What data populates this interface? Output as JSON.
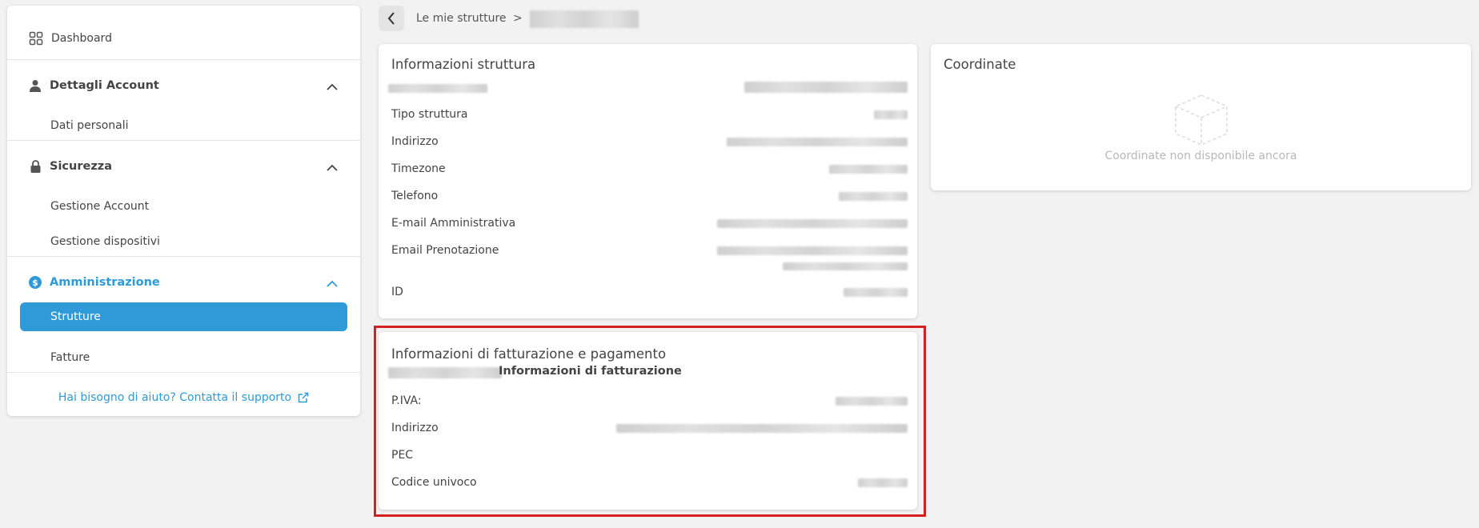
{
  "sidebar": {
    "dashboard": "Dashboard",
    "account_section": "Dettagli Account",
    "dati_personali": "Dati personali",
    "security_section": "Sicurezza",
    "gestione_account": "Gestione Account",
    "gestione_dispositivi": "Gestione dispositivi",
    "admin_section": "Amministrazione",
    "strutture": "Strutture",
    "fatture": "Fatture",
    "help": "Hai bisogno di aiuto? Contatta il supporto"
  },
  "breadcrumb": {
    "parent": "Le mie strutture",
    "separator": ">"
  },
  "structure_card": {
    "title": "Informazioni struttura",
    "fields": [
      "Tipo struttura",
      "Indirizzo",
      "Timezone",
      "Telefono",
      "E-mail Amministrativa",
      "Email Prenotazione",
      "ID"
    ]
  },
  "coords_card": {
    "title": "Coordinate",
    "empty": "Coordinate non disponibile ancora"
  },
  "billing_card": {
    "title": "Informazioni di fatturazione e pagamento",
    "subtitle": "Informazioni di fatturazione",
    "fields": [
      "P.IVA:",
      "Indirizzo",
      "PEC",
      "Codice univoco"
    ]
  },
  "colors": {
    "accent": "#2e9ad8",
    "highlight": "#d42020"
  }
}
